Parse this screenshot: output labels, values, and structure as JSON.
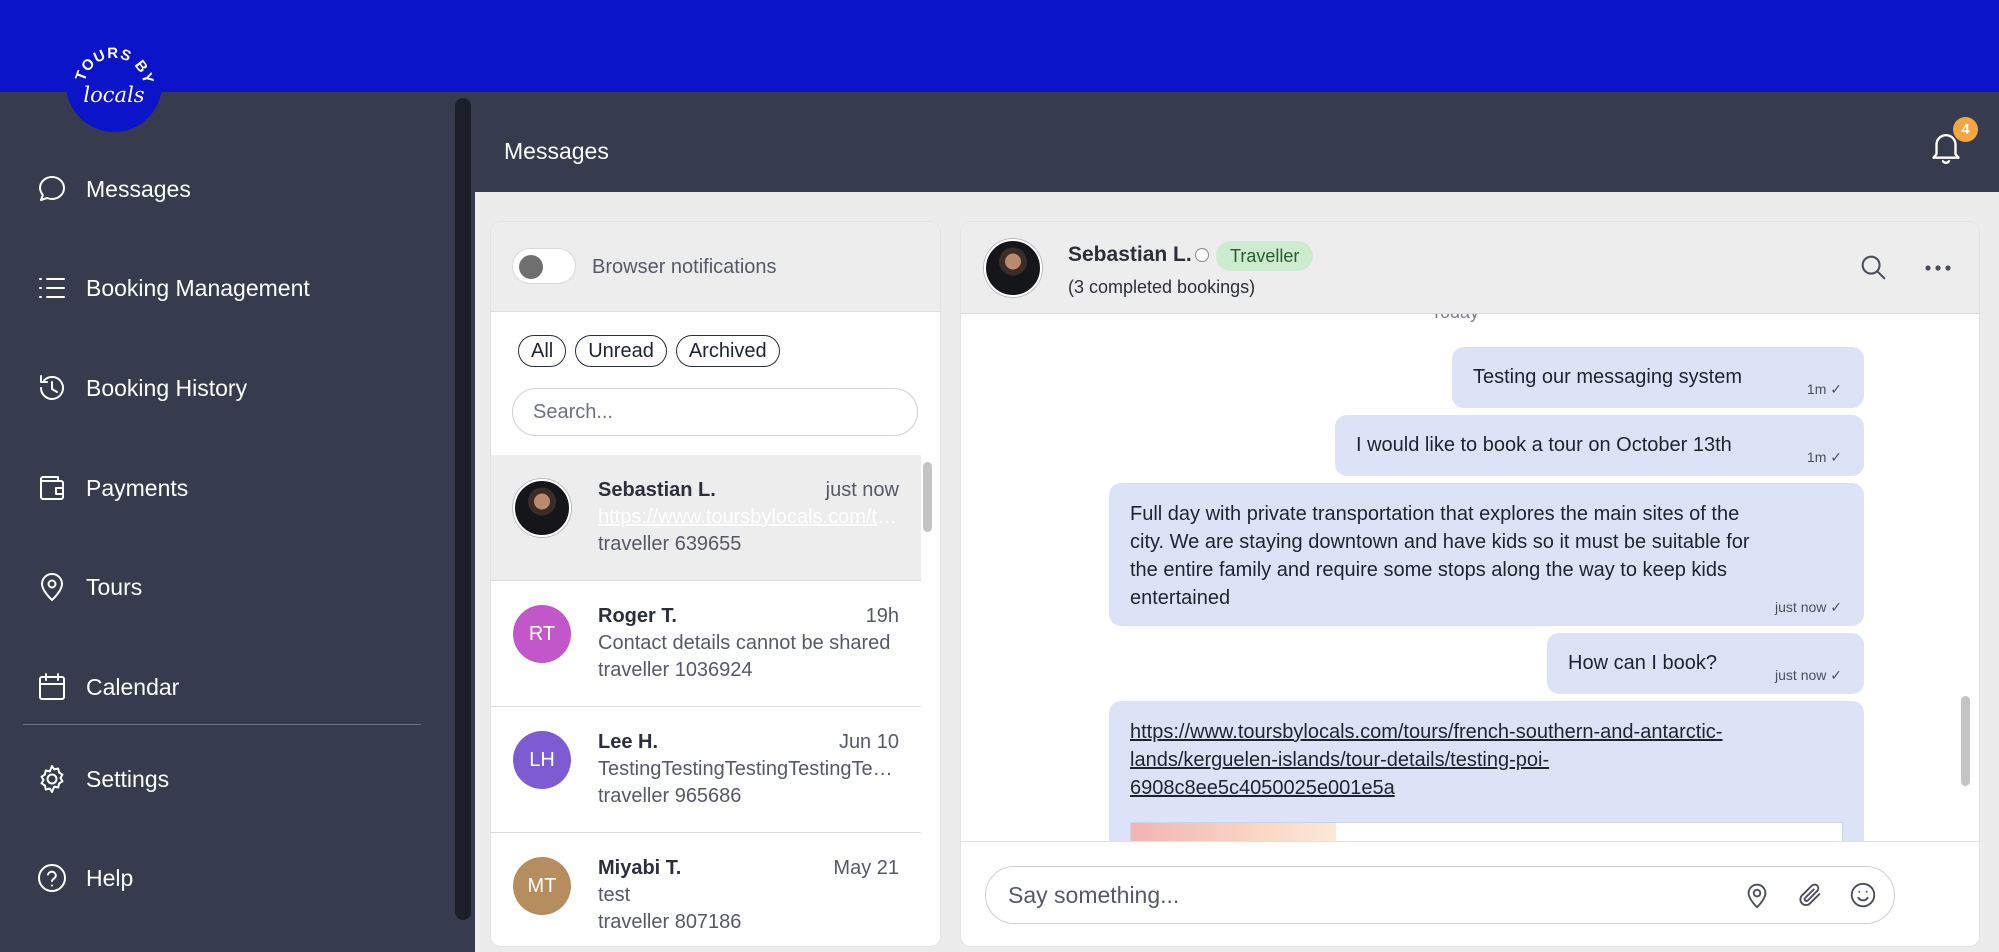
{
  "brand": {
    "logo_text_top": "TOURS BY",
    "logo_text_script": "locals"
  },
  "sidebar": {
    "items": [
      {
        "label": "Messages",
        "icon": "chat-bubble-icon"
      },
      {
        "label": "Booking Management",
        "icon": "list-icon"
      },
      {
        "label": "Booking History",
        "icon": "history-icon"
      },
      {
        "label": "Payments",
        "icon": "wallet-icon"
      },
      {
        "label": "Tours",
        "icon": "map-pin-icon"
      },
      {
        "label": "Calendar",
        "icon": "calendar-icon"
      },
      {
        "label": "Settings",
        "icon": "gear-icon"
      },
      {
        "label": "Help",
        "icon": "help-icon"
      }
    ]
  },
  "header": {
    "title": "Messages",
    "notification_count": "4"
  },
  "conversations": {
    "browser_notifications_label": "Browser notifications",
    "filters": [
      "All",
      "Unread",
      "Archived"
    ],
    "search_placeholder": "Search...",
    "items": [
      {
        "name": "Sebastian L.",
        "time": "just now",
        "preview": "https://www.toursbylocals.com/tours/french-southern-and-antarctic-lands",
        "sub": "traveller 639655",
        "initials": "",
        "avatar_color": ""
      },
      {
        "name": "Roger T.",
        "time": "19h",
        "preview": "Contact details cannot be shared",
        "sub": "traveller 1036924",
        "initials": "RT",
        "avatar_color": "#c257c9"
      },
      {
        "name": "Lee H.",
        "time": "Jun 10",
        "preview": "TestingTestingTestingTestingTesting",
        "sub": "traveller 965686",
        "initials": "LH",
        "avatar_color": "#7c5bd3"
      },
      {
        "name": "Miyabi T.",
        "time": "May 21",
        "preview": "test",
        "sub": "traveller 807186",
        "initials": "MT",
        "avatar_color": "#b58d5e"
      }
    ]
  },
  "chat": {
    "name": "Sebastian L.",
    "role": "Traveller",
    "sub": "(3 completed bookings)",
    "date_separator": "Today",
    "messages": [
      {
        "text": "Testing our messaging system",
        "meta": "1m ✓"
      },
      {
        "text": "I would like to book a tour on October 13th",
        "meta": "1m ✓"
      },
      {
        "lines": [
          "Full day with private transportation that explores the main sites of the",
          "city. We are staying downtown and have kids so it must be suitable for",
          "the entire family and require some stops along the way to keep kids",
          "entertained"
        ],
        "meta": "just now ✓"
      },
      {
        "text": "How can I book?",
        "meta": "just now ✓"
      },
      {
        "link_lines": [
          "https://www.toursbylocals.com/tours/french-southern-and-antarctic-",
          "lands/kerguelen-islands/tour-details/testing-poi-",
          "6908c8ee5c4050025e001e5a"
        ]
      }
    ],
    "composer_placeholder": "Say something..."
  }
}
